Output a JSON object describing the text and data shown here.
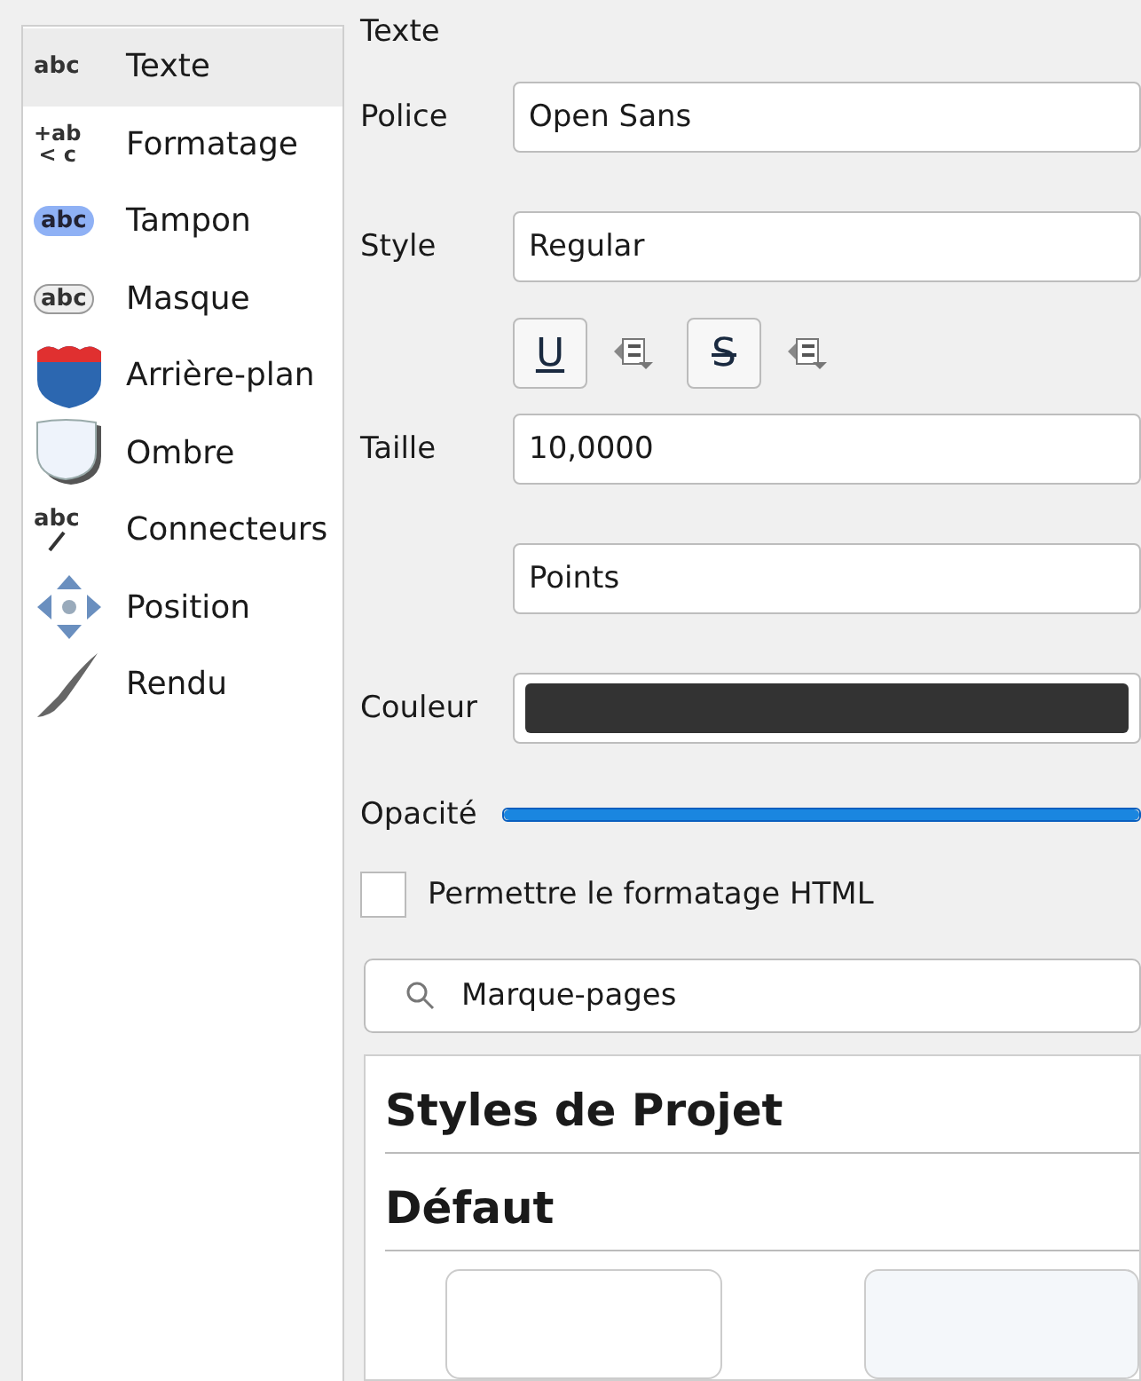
{
  "sidebar": {
    "items": [
      {
        "label": "Texte",
        "kind": "text",
        "icon_lines": [
          "abc"
        ],
        "selected": true
      },
      {
        "label": "Formatage",
        "kind": "format",
        "icon_lines": [
          "+ab",
          "< c"
        ],
        "selected": false
      },
      {
        "label": "Tampon",
        "kind": "buffer",
        "icon_lines": [
          "abc"
        ],
        "selected": false
      },
      {
        "label": "Masque",
        "kind": "mask",
        "icon_lines": [
          "abc"
        ],
        "selected": false
      },
      {
        "label": "Arrière-plan",
        "kind": "background",
        "selected": false
      },
      {
        "label": "Ombre",
        "kind": "shadow",
        "selected": false
      },
      {
        "label": "Connecteurs",
        "kind": "callout",
        "icon_lines": [
          "abc"
        ],
        "selected": false
      },
      {
        "label": "Position",
        "kind": "placement",
        "selected": false
      },
      {
        "label": "Rendu",
        "kind": "rendering",
        "selected": false
      }
    ]
  },
  "panel": {
    "title": "Texte",
    "rows": [
      {
        "kind": "combo",
        "label": "Police",
        "value": "Open Sans"
      },
      {
        "kind": "combo",
        "label": "Style",
        "value": "Regular"
      },
      {
        "kind": "buttons",
        "buttons": [
          {
            "text": "U",
            "kind": "underline"
          },
          {
            "text": "S",
            "kind": "strike"
          }
        ]
      },
      {
        "kind": "combo",
        "label": "Taille",
        "value": "10,0000"
      },
      {
        "kind": "combo",
        "value": "Points"
      },
      {
        "kind": "color",
        "label": "Couleur",
        "color": "#333333"
      },
      {
        "kind": "slider",
        "label": "Opacité",
        "level": 1.0
      },
      {
        "kind": "checkbox",
        "label": "Permettre le formatage HTML",
        "checked": false
      }
    ],
    "search": {
      "placeholder": "Marque-pages"
    },
    "styles": {
      "sections": [
        "Styles de Projet",
        "Défaut"
      ]
    }
  }
}
